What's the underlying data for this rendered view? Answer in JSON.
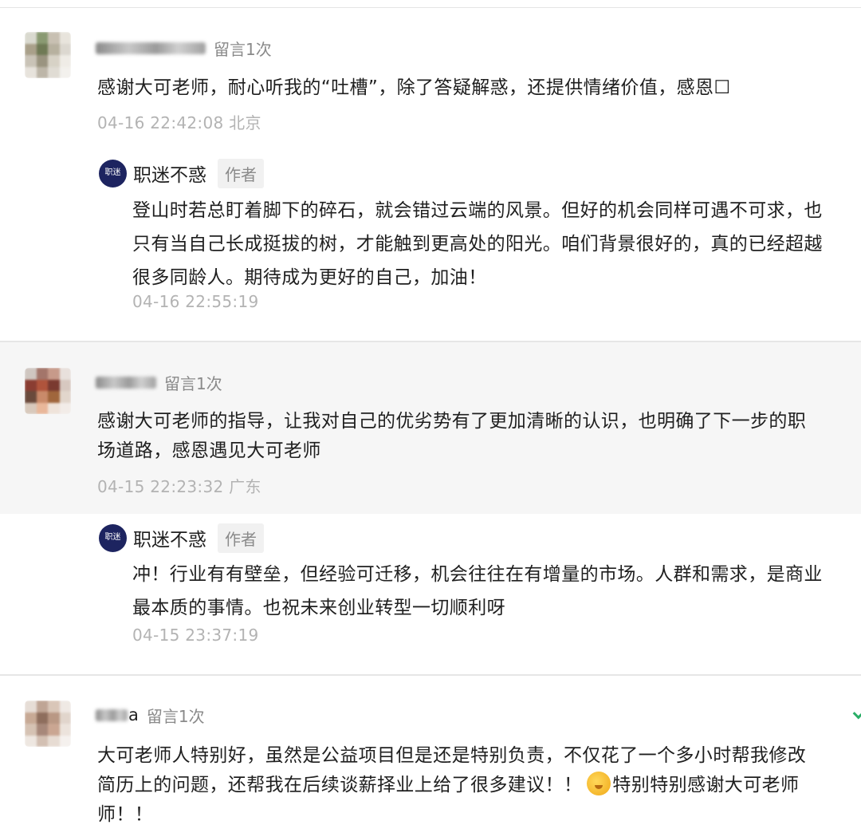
{
  "comments": [
    {
      "count": "留言1次",
      "text": "感谢大可老师，耐心听我的“吐槽”，除了答疑解惑，还提供情绪价值，感恩",
      "tail": "☐",
      "meta": "04-16 22:42:08 北京",
      "reply": {
        "author": "职迷不惑",
        "tag": "作者",
        "lines": [
          "登山时若总盯着脚下的碎石，就会错过云端的风景。但好的机会同样可遇不可求，也",
          "只有当自己长成挺拔的树，才能触到更高处的阳光。咱们背景很好的，真的已经超越",
          "很多同龄人。期待成为更好的自己，加油！"
        ],
        "time": "04-16 22:55:19"
      }
    },
    {
      "count": "留言1次",
      "lines": [
        "感谢大可老师的指导，让我对自己的优劣势有了更加清晰的认识，也明确了下一步的职",
        "场道路，感恩遇见大可老师"
      ],
      "meta": "04-15 22:23:32 广东",
      "reply": {
        "author": "职迷不惑",
        "tag": "作者",
        "lines": [
          "冲！行业有有壁垒，但经验可迁移，机会往往在有增量的市场。人群和需求，是商业",
          "最本质的事情。也祝未来创业转型一切顺利呀"
        ],
        "time": "04-15 23:37:19"
      }
    },
    {
      "count": "留言1次",
      "name_visible_fragment": "a",
      "lines": [
        "大可老师人特别好，虽然是公益项目但是还是特别负责，不仅花了一个多小时帮我修改",
        "简历上的问题，还帮我在后续谈薪择业上给了很多建议！！",
        "师！！"
      ],
      "line2_tail": "特别特别感谢大可老师",
      "emoji": "shushing-face-emoji"
    }
  ],
  "logo_text": "职迷",
  "colors": {
    "author_logo": "#1d2460",
    "meta": "#b3b3b3",
    "shaded_block": "#f6f6f6"
  }
}
